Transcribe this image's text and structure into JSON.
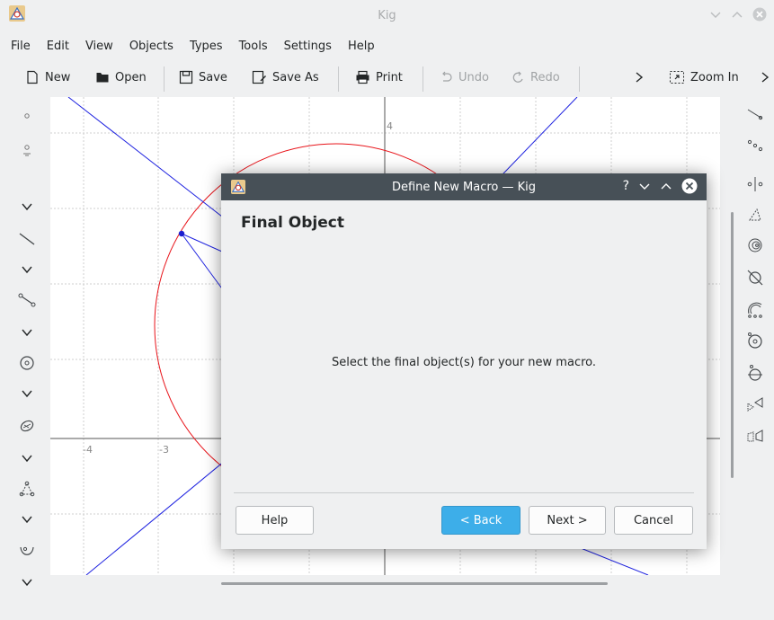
{
  "window": {
    "title": "Kig"
  },
  "menu": [
    "File",
    "Edit",
    "View",
    "Objects",
    "Types",
    "Tools",
    "Settings",
    "Help"
  ],
  "toolbar": {
    "new": "New",
    "open": "Open",
    "save": "Save",
    "save_as": "Save As",
    "print": "Print",
    "undo": "Undo",
    "redo": "Redo",
    "zoom_in": "Zoom In"
  },
  "canvas": {
    "axis_labels": {
      "y4": "4",
      "xm4": "-4",
      "xm3": "-3"
    },
    "colors": {
      "circle": "#e8141a",
      "lines": "#1e22e0",
      "grid": "#c8c8c8",
      "point": "#1b1dcf"
    }
  },
  "dialog": {
    "title": "Define New Macro — Kig",
    "heading": "Final Object",
    "message": "Select the final object(s) for your new macro.",
    "buttons": {
      "help": "Help",
      "back": "< Back",
      "next": "Next >",
      "cancel": "Cancel"
    },
    "title_controls": [
      "?",
      "minimize",
      "maximize",
      "close"
    ]
  },
  "icons": {
    "left": [
      "point-icon",
      "point-tool-icon",
      "chevron-down-icon",
      "line-icon",
      "chevron-down-icon",
      "segment-icon",
      "chevron-down-icon",
      "circle-icon",
      "chevron-down-icon",
      "conic-icon",
      "chevron-down-icon",
      "polygon-icon",
      "chevron-down-icon",
      "curve-icon",
      "chevron-down-icon"
    ],
    "right": [
      "midpoint-icon",
      "distance-icon",
      "mirror-icon",
      "triangle-icon",
      "spiral-icon",
      "cross-circle-icon",
      "arc-icon",
      "circle-point-icon",
      "tangent-icon",
      "transform-icon",
      "polygon-transform-icon"
    ]
  }
}
